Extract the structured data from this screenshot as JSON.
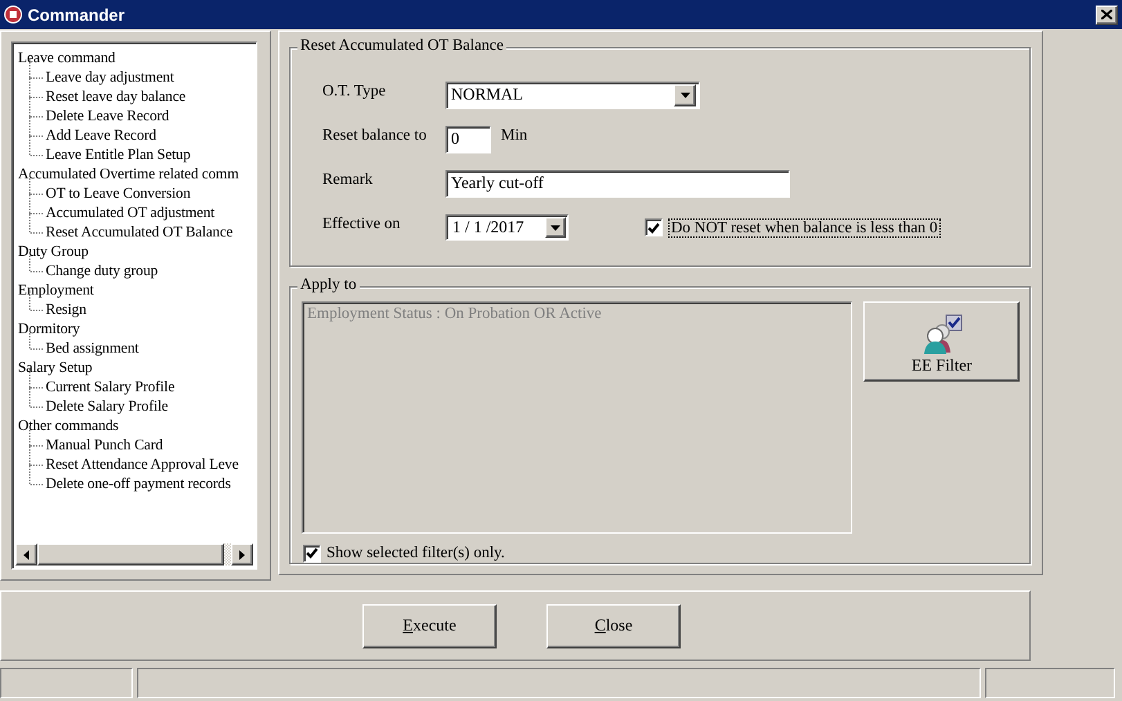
{
  "window": {
    "title": "Commander"
  },
  "tree": [
    {
      "label": "Leave command",
      "children": [
        {
          "label": "Leave day adjustment"
        },
        {
          "label": "Reset leave day balance"
        },
        {
          "label": "Delete Leave Record"
        },
        {
          "label": "Add Leave Record"
        },
        {
          "label": "Leave Entitle Plan Setup"
        }
      ]
    },
    {
      "label": "Accumulated Overtime related comm",
      "children": [
        {
          "label": "OT to Leave Conversion"
        },
        {
          "label": "Accumulated OT adjustment"
        },
        {
          "label": "Reset Accumulated OT Balance"
        }
      ]
    },
    {
      "label": "Duty Group",
      "children": [
        {
          "label": "Change duty group"
        }
      ]
    },
    {
      "label": "Employment",
      "children": [
        {
          "label": "Resign"
        }
      ]
    },
    {
      "label": "Dormitory",
      "children": [
        {
          "label": "Bed assignment"
        }
      ]
    },
    {
      "label": "Salary Setup",
      "children": [
        {
          "label": "Current Salary Profile"
        },
        {
          "label": "Delete Salary Profile"
        }
      ]
    },
    {
      "label": "Other commands",
      "children": [
        {
          "label": "Manual Punch Card"
        },
        {
          "label": "Reset Attendance Approval Leve"
        },
        {
          "label": "Delete one-off payment records"
        }
      ]
    }
  ],
  "form": {
    "title": "Reset Accumulated OT Balance",
    "ot_type": {
      "label": "O.T. Type",
      "value": "NORMAL"
    },
    "reset_balance": {
      "label": "Reset balance to",
      "value": "0",
      "unit": "Min"
    },
    "remark": {
      "label": "Remark",
      "value": "Yearly cut-off"
    },
    "effective_on": {
      "label": "Effective on",
      "value": "1 / 1 /2017"
    },
    "no_reset": {
      "label": "Do NOT reset when balance is less than 0",
      "checked": true
    }
  },
  "apply_to": {
    "title": "Apply to",
    "filters": [
      "Employment Status : On Probation OR Active"
    ],
    "filter_button": "EE Filter",
    "show_selected": {
      "label": "Show selected filter(s) only.",
      "checked": true
    }
  },
  "buttons": [
    {
      "label": "Execute"
    },
    {
      "label": "Close"
    }
  ]
}
